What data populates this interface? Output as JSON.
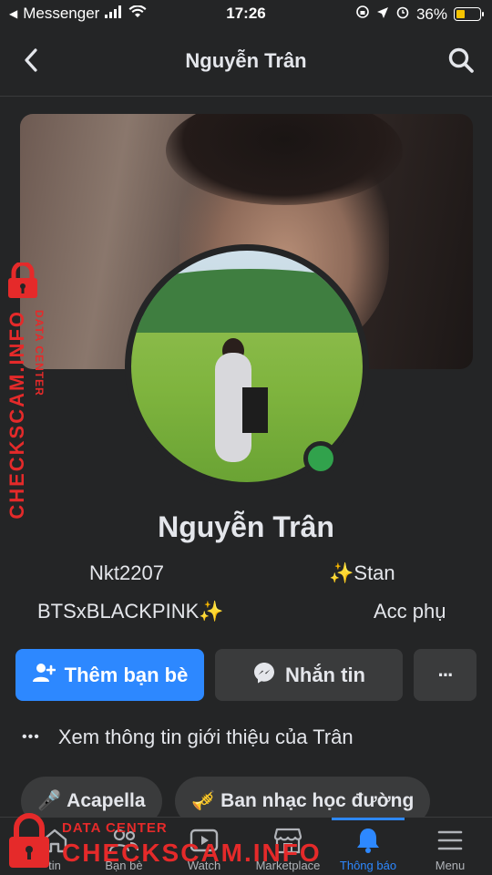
{
  "status_bar": {
    "app_back": "Messenger",
    "time": "17:26",
    "battery_percent": "36%",
    "battery_level": 0.36,
    "battery_color": "#f5c400"
  },
  "header": {
    "title": "Nguyễn Trân",
    "back_icon": "chevron-left-icon",
    "search_icon": "search-icon"
  },
  "profile": {
    "name": "Nguyễn Trân",
    "online": true,
    "bio": {
      "line1_left": "Nkt2207",
      "line1_right": "✨Stan",
      "line2_left": "BTSxBLACKPINK✨",
      "line2_right": "Acc phụ"
    }
  },
  "actions": {
    "add_friend": "Thêm bạn bè",
    "message": "Nhắn tin",
    "more": "···"
  },
  "intro": {
    "dots": "•••",
    "text": "Xem thông tin giới thiệu của Trân"
  },
  "chips": [
    {
      "emoji": "🎤",
      "label": "Acapella"
    },
    {
      "emoji": "🎺",
      "label": "Ban nhạc học đường"
    }
  ],
  "tabs": [
    {
      "label": "tin",
      "icon": "home-icon"
    },
    {
      "label": "Bạn bè",
      "icon": "friends-icon"
    },
    {
      "label": "Watch",
      "icon": "watch-icon"
    },
    {
      "label": "Marketplace",
      "icon": "marketplace-icon"
    },
    {
      "label": "Thông báo",
      "icon": "bell-icon",
      "active": true
    },
    {
      "label": "Menu",
      "icon": "menu-icon"
    }
  ],
  "watermark": {
    "small": "DATA CENTER",
    "big": "CHECKSCAM.INFO",
    "color": "#e52a2a"
  },
  "colors": {
    "accent": "#2d88ff",
    "background": "#242526",
    "surface": "#3a3b3c",
    "online": "#31a24c"
  }
}
